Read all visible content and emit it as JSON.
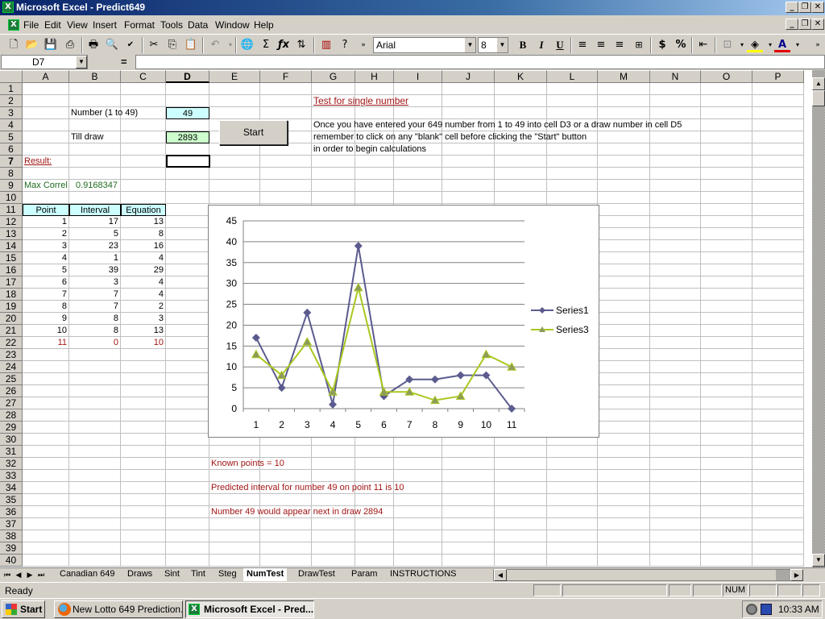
{
  "window": {
    "title": "Microsoft Excel - Predict649",
    "controls": [
      "minimize",
      "restore",
      "close"
    ]
  },
  "menubar": {
    "items": [
      {
        "label": "File",
        "accel": "F"
      },
      {
        "label": "Edit",
        "accel": "E"
      },
      {
        "label": "View",
        "accel": "V"
      },
      {
        "label": "Insert",
        "accel": "I"
      },
      {
        "label": "Format",
        "accel": "o"
      },
      {
        "label": "Tools",
        "accel": "T"
      },
      {
        "label": "Data",
        "accel": "D"
      },
      {
        "label": "Window",
        "accel": "W"
      },
      {
        "label": "Help",
        "accel": "H"
      }
    ]
  },
  "toolbar": {
    "icons": [
      "new-icon",
      "open-icon",
      "save-icon",
      "permission-icon",
      "print-icon",
      "print-preview-icon",
      "spelling-icon",
      "cut-icon",
      "copy-icon",
      "paste-icon",
      "undo-icon",
      "insert-hyperlink-icon",
      "autosum-icon",
      "function-icon",
      "sort-ascending-icon",
      "chart-wizard-icon",
      "help-icon",
      "more-icon"
    ],
    "font_name": "Arial",
    "font_size": "8",
    "format_labels": {
      "bold": "B",
      "italic": "I",
      "underline": "U",
      "currency": "$",
      "percent": "%"
    }
  },
  "formula_bar": {
    "name_box": "D7",
    "equals": "=",
    "formula": ""
  },
  "sheet": {
    "columns": [
      "A",
      "B",
      "C",
      "D",
      "E",
      "F",
      "G",
      "H",
      "I",
      "J",
      "K",
      "L",
      "M",
      "N",
      "O",
      "P"
    ],
    "active_column": "D",
    "active_row": 7,
    "row_count": 40,
    "cells": {
      "B3": "Number (1 to 49)",
      "D3": "49",
      "B5": "Till draw",
      "D5": "2893",
      "A7": "Result:",
      "A9": "Max Correl",
      "B9": "0.9168347",
      "G2": "Test for single number",
      "G4": "Once you have entered your 649 number from 1 to 49 into cell D3 or a draw number in cell D5",
      "G5": "remember to click on any \"blank\" cell before clicking the \"Start\" button",
      "G6": "in order to begin calculations",
      "E32": "Known points = 10",
      "E34": "Predicted interval for number 49 on point 11 is 10",
      "E36": "Number 49 would appear next in draw 2894"
    },
    "table": {
      "headers": [
        "Point",
        "Interval",
        "Equation"
      ],
      "rows": [
        [
          "1",
          "17",
          "13"
        ],
        [
          "2",
          "5",
          "8"
        ],
        [
          "3",
          "23",
          "16"
        ],
        [
          "4",
          "1",
          "4"
        ],
        [
          "5",
          "39",
          "29"
        ],
        [
          "6",
          "3",
          "4"
        ],
        [
          "7",
          "7",
          "4"
        ],
        [
          "8",
          "7",
          "2"
        ],
        [
          "9",
          "8",
          "3"
        ],
        [
          "10",
          "8",
          "13"
        ],
        [
          "11",
          "0",
          "10"
        ]
      ]
    },
    "start_button": "Start"
  },
  "chart_data": {
    "type": "line",
    "title": "",
    "xlabel": "",
    "ylabel": "",
    "categories": [
      "1",
      "2",
      "3",
      "4",
      "5",
      "6",
      "7",
      "8",
      "9",
      "10",
      "11"
    ],
    "series": [
      {
        "name": "Series1",
        "values": [
          17,
          5,
          23,
          1,
          39,
          3,
          7,
          7,
          8,
          8,
          0
        ],
        "color": "#5b5b8f",
        "marker": "diamond"
      },
      {
        "name": "Series3",
        "values": [
          13,
          8,
          16,
          4,
          29,
          4,
          4,
          2,
          3,
          13,
          10
        ],
        "color": "#a8c820",
        "marker": "triangle"
      }
    ],
    "ylim": [
      0,
      45
    ],
    "yticks": [
      0,
      5,
      10,
      15,
      20,
      25,
      30,
      35,
      40,
      45
    ],
    "grid": true,
    "legend": "right"
  },
  "sheet_tabs": {
    "tabs": [
      "Canadian 649",
      "Draws",
      "Sint",
      "Tint",
      "Steg",
      "NumTest",
      "DrawTest",
      "Param",
      "INSTRUCTIONS"
    ],
    "active": "NumTest"
  },
  "statusbar": {
    "status": "Ready",
    "num": "NUM"
  },
  "taskbar": {
    "start": "Start",
    "tasks": [
      {
        "label": "New Lotto 649 Prediction...",
        "active": false
      },
      {
        "label": "Microsoft Excel - Pred...",
        "active": true
      }
    ],
    "clock": "10:33 AM"
  },
  "colors": {
    "input_number_bg": "#ccffff",
    "input_draw_bg": "#ccffcc",
    "result_red": "#a31515",
    "correl_green": "#1f6b1f"
  }
}
